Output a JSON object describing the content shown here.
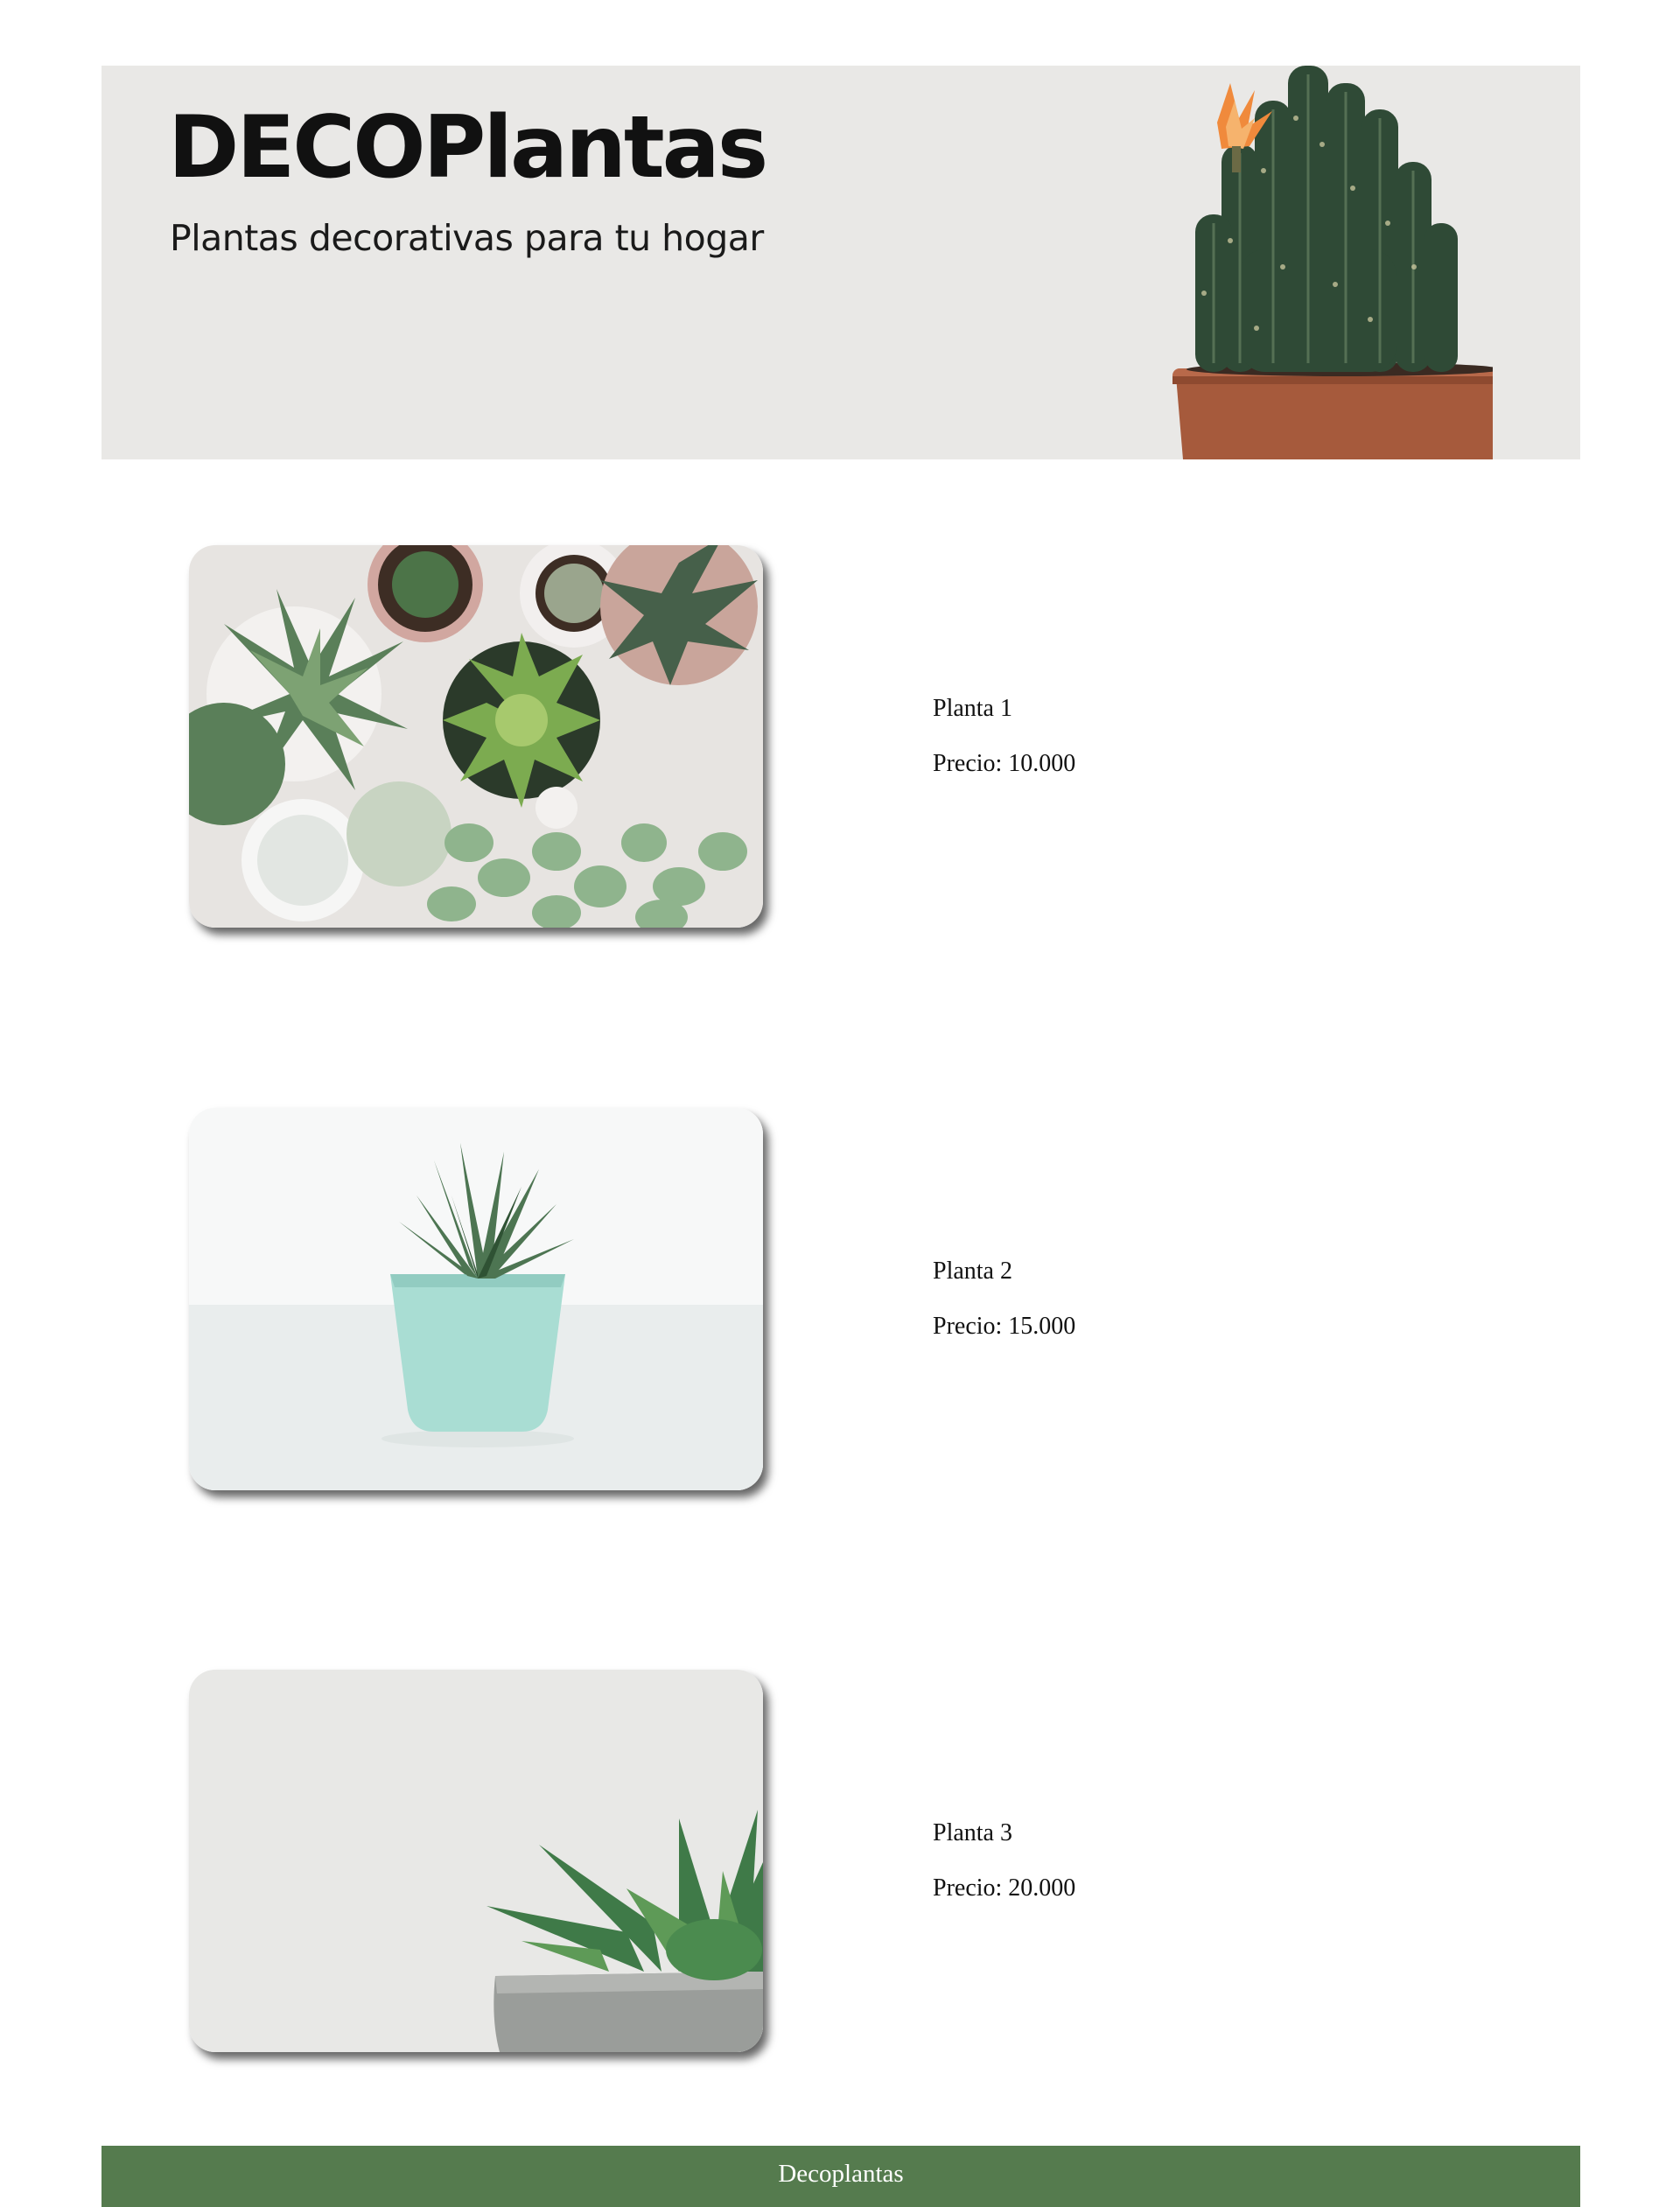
{
  "header": {
    "brand": "DECOPlantas",
    "tagline": "Plantas decorativas para tu hogar",
    "image_icon": "cactus-in-terracotta-pot"
  },
  "products": [
    {
      "image_icon": "assorted-succulents-top-view",
      "name": "Planta 1",
      "price": "Precio: 10.000"
    },
    {
      "image_icon": "succulent-in-mint-pot",
      "name": "Planta 2",
      "price": "Precio: 15.000"
    },
    {
      "image_icon": "succulent-in-concrete-pot",
      "name": "Planta 3",
      "price": "Precio: 20.000"
    }
  ],
  "footer": {
    "text": "Decoplantas"
  },
  "colors": {
    "header_bg": "#e9e8e6",
    "footer_bg": "#557b4e",
    "footer_text": "#ffffff"
  }
}
